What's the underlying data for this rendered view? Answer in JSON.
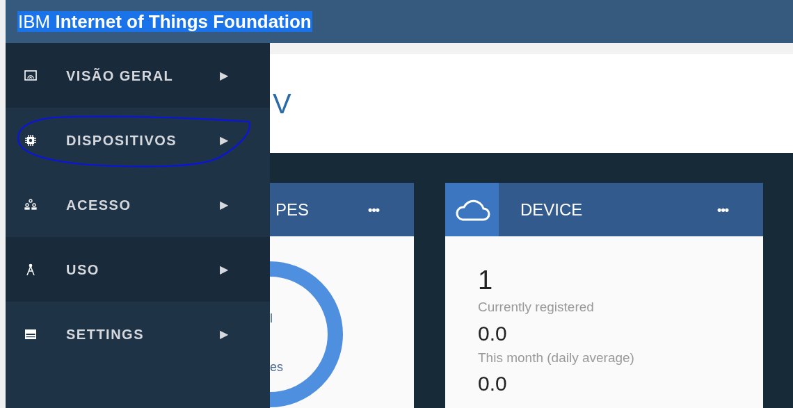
{
  "header": {
    "brand": "IBM",
    "title": "Internet of Things Foundation"
  },
  "page": {
    "title": "V"
  },
  "cards": [
    {
      "kind": "donut",
      "title": "PES",
      "more": "•••",
      "labels": [
        "l",
        "es"
      ]
    },
    {
      "kind": "stats",
      "title": "DEVICE",
      "more": "•••",
      "stats": [
        {
          "value": "1",
          "label": "Currently registered"
        },
        {
          "value": "0.0",
          "label": "This month (daily average)"
        },
        {
          "value": "0.0"
        }
      ]
    }
  ],
  "menu": [
    {
      "label": "VISÃO GERAL",
      "arrow": "▶",
      "highlighted": true,
      "annotated": false
    },
    {
      "label": "DISPOSITIVOS",
      "arrow": "▶",
      "highlighted": false,
      "annotated": true
    },
    {
      "label": "ACESSO",
      "arrow": "▶",
      "highlighted": false,
      "annotated": false
    },
    {
      "label": "USO",
      "arrow": "▶",
      "highlighted": true,
      "annotated": false
    },
    {
      "label": "SETTINGS",
      "arrow": "▶",
      "highlighted": false,
      "annotated": false
    }
  ]
}
